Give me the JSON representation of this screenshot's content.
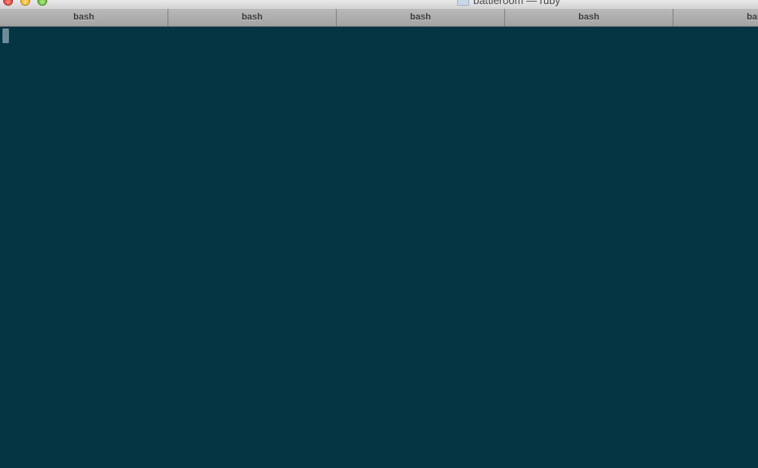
{
  "window": {
    "title": "battleroom — ruby"
  },
  "icons": {
    "title_icon": "folder-icon"
  },
  "tabs": [
    {
      "label": "bash"
    },
    {
      "label": "bash"
    },
    {
      "label": "bash"
    },
    {
      "label": "bash"
    },
    {
      "label": "bash"
    }
  ],
  "terminal": {
    "text": ""
  },
  "colors": {
    "terminal_background": "#053542",
    "cursor": "#6d8c96",
    "tabbar": "#a4a4a4"
  }
}
